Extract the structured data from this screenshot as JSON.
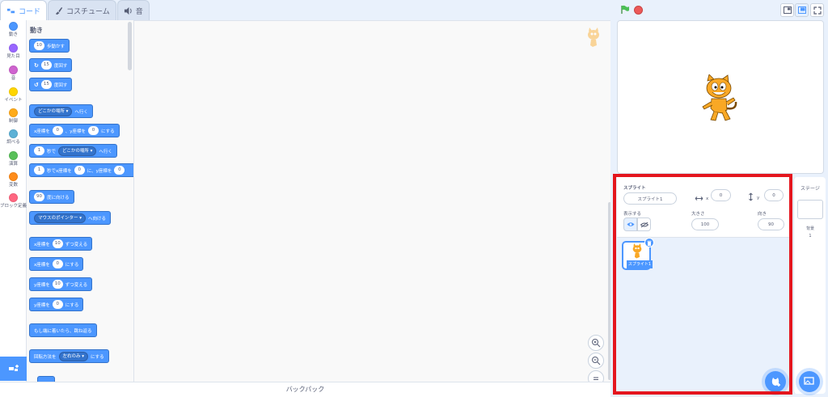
{
  "tabs": [
    {
      "label": "コード",
      "active": true
    },
    {
      "label": "コスチューム",
      "active": false
    },
    {
      "label": "音",
      "active": false
    }
  ],
  "categories": [
    {
      "label": "動き",
      "color": "#4c97ff"
    },
    {
      "label": "見た目",
      "color": "#9966ff"
    },
    {
      "label": "音",
      "color": "#cf63cf"
    },
    {
      "label": "イベント",
      "color": "#ffd500"
    },
    {
      "label": "制御",
      "color": "#ffab19"
    },
    {
      "label": "調べる",
      "color": "#5cb1d6"
    },
    {
      "label": "演算",
      "color": "#59c059"
    },
    {
      "label": "変数",
      "color": "#ff8c1a"
    },
    {
      "label": "ブロック定義",
      "color": "#ff6680"
    }
  ],
  "palette": {
    "title": "動き",
    "blocks": {
      "move": {
        "val": "10",
        "text": "歩動かす"
      },
      "turn_right": {
        "val": "15",
        "text": "度回す"
      },
      "turn_left": {
        "val": "15",
        "text": "度回す"
      },
      "goto": {
        "drop": "どこかの場所",
        "text": "へ行く"
      },
      "goto_xy": {
        "t1": "x座標を",
        "v1": "0",
        "t2": "、y座標を",
        "v2": "0",
        "t3": "にする"
      },
      "glide": {
        "v1": "1",
        "t1": "秒で",
        "drop": "どこかの場所",
        "t2": "へ行く"
      },
      "glide_xy": {
        "v1": "1",
        "t1": "秒でx座標を",
        "v2": "0",
        "t2": "に、y座標を",
        "v3": "0"
      },
      "point_dir": {
        "val": "90",
        "text": "度に向ける"
      },
      "point_towards": {
        "drop": "マウスのポインター",
        "text": "へ向ける"
      },
      "change_x": {
        "t1": "x座標を",
        "val": "10",
        "t2": "ずつ変える"
      },
      "set_x": {
        "t1": "x座標を",
        "val": "0",
        "t2": "にする"
      },
      "change_y": {
        "t1": "y座標を",
        "val": "10",
        "t2": "ずつ変える"
      },
      "set_y": {
        "t1": "y座標を",
        "val": "0",
        "t2": "にする"
      },
      "bounce": {
        "text": "もし端に着いたら、跳ね返る"
      },
      "rotation": {
        "t1": "回転方法を",
        "drop": "左右のみ",
        "t2": "にする"
      }
    }
  },
  "backpack_label": "バックパック",
  "sprite_info": {
    "sprite_label": "スプライト",
    "sprite_name": "スプライト1",
    "x_label": "x",
    "x_value": "0",
    "y_label": "y",
    "y_value": "0",
    "show_label": "表示する",
    "size_label": "大きさ",
    "size_value": "100",
    "direction_label": "向き",
    "direction_value": "90"
  },
  "sprite_list": [
    {
      "name": "スプライト1",
      "selected": true
    }
  ],
  "stage_pane": {
    "title": "ステージ",
    "backdrops_label": "背景",
    "backdrops_count": "1"
  },
  "colors": {
    "accent": "#4c97ff",
    "highlight": "#e4161e",
    "flag": "#4cbf56",
    "stop": "#ec5959"
  }
}
